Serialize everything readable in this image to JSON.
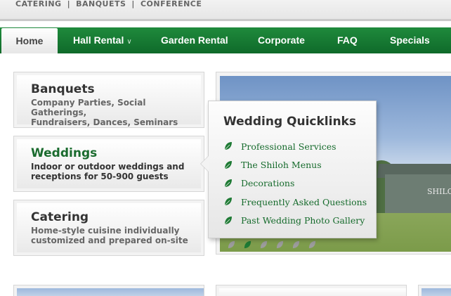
{
  "header": {
    "tag_links": [
      "CATERING",
      "BANQUETS",
      "CONFERENCE"
    ],
    "separator": "|"
  },
  "nav": {
    "items": [
      {
        "label": "Home"
      },
      {
        "label": "Hall Rental",
        "caret": "∨"
      },
      {
        "label": "Garden Rental"
      },
      {
        "label": "Corporate"
      },
      {
        "label": "FAQ"
      },
      {
        "label": "Specials"
      }
    ]
  },
  "cards": {
    "banquets": {
      "title": "Banquets",
      "desc_line1": "Company Parties, Social Gatherings,",
      "desc_line2": "Fundraisers, Dances, Seminars"
    },
    "weddings": {
      "title": "Weddings",
      "desc_line1": "Indoor or outdoor weddings and",
      "desc_line2": "receptions for 50-900 guests"
    },
    "catering": {
      "title": "Catering",
      "desc_line1": "Home-style cuisine individually",
      "desc_line2": "customized and prepared on-site"
    }
  },
  "popup": {
    "title": "Wedding Quicklinks",
    "links": [
      {
        "label": "Professional Services"
      },
      {
        "label": "The Shiloh Menus"
      },
      {
        "label": "Decorations"
      },
      {
        "label": "Frequently Asked Questions"
      },
      {
        "label": "Past Wedding Photo Gallery"
      }
    ]
  },
  "photo": {
    "sign_text": "SHILOH"
  },
  "slider": {
    "count": 6,
    "active_index": 1
  },
  "colors": {
    "nav_green": "#1a7a35",
    "link_green": "#166b2c",
    "leaf_active": "#1e7a34",
    "leaf_inactive": "#9c9c9c"
  }
}
